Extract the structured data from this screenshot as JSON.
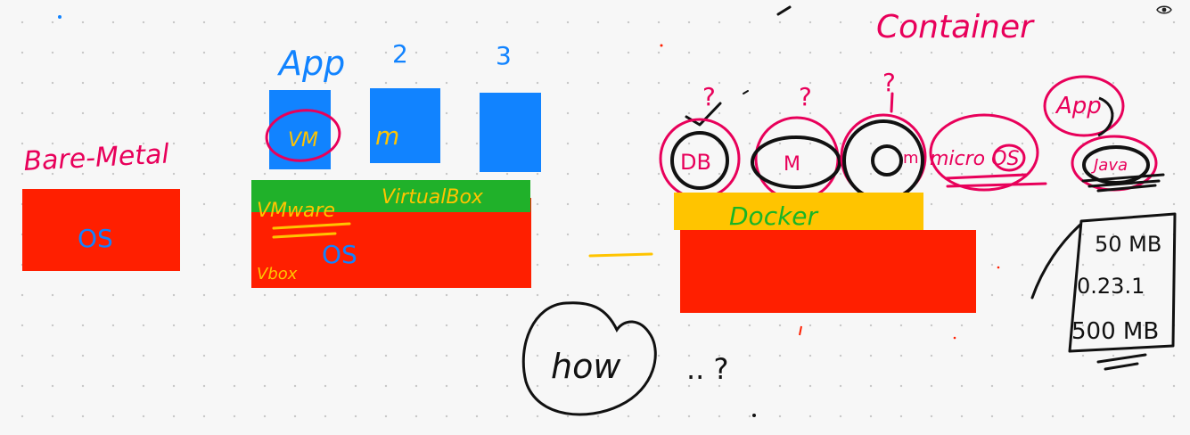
{
  "colors": {
    "red": "#ff1f00",
    "blue": "#1183ff",
    "green": "#20b12a",
    "yellow": "#ffc400",
    "pink": "#e8005a",
    "black": "#111111"
  },
  "bare_metal": {
    "title": "Bare-Metal",
    "os": "OS"
  },
  "virtualization": {
    "app_label": "App",
    "app_2": "2",
    "app_3": "3",
    "vm": "VM",
    "vm_2_mark": "m",
    "hypervisor_vmware": "VMware",
    "hypervisor_virtualbox": "VirtualBox",
    "os": "OS",
    "os_note": "Vbox"
  },
  "container": {
    "title": "Container",
    "db": "DB",
    "app_2": "M",
    "app_3": "m",
    "question_1": "?",
    "question_2": "?",
    "question_3": "?",
    "micro_os": "micro OS",
    "app_label": "App",
    "java": "Java",
    "docker": "Docker",
    "sizes": [
      "50 MB",
      "0.23.1",
      "500 MB"
    ]
  },
  "notes": {
    "how": "how",
    "ellipsis_question": ".. ?"
  },
  "icons": {
    "visibility": "eye-icon"
  }
}
